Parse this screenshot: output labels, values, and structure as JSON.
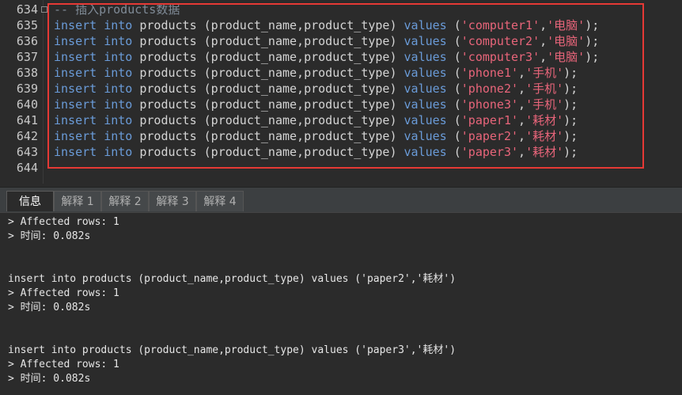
{
  "editor": {
    "lines": [
      {
        "num": "634",
        "kind": "comment",
        "text": "-- 插入products数据"
      },
      {
        "num": "635",
        "kind": "insert",
        "v1": "'computer1'",
        "v2": "'电脑'"
      },
      {
        "num": "636",
        "kind": "insert",
        "v1": "'computer2'",
        "v2": "'电脑'"
      },
      {
        "num": "637",
        "kind": "insert",
        "v1": "'computer3'",
        "v2": "'电脑'"
      },
      {
        "num": "638",
        "kind": "insert",
        "v1": "'phone1'",
        "v2": "'手机'"
      },
      {
        "num": "639",
        "kind": "insert",
        "v1": "'phone2'",
        "v2": "'手机'"
      },
      {
        "num": "640",
        "kind": "insert",
        "v1": "'phone3'",
        "v2": "'手机'"
      },
      {
        "num": "641",
        "kind": "insert",
        "v1": "'paper1'",
        "v2": "'耗材'"
      },
      {
        "num": "642",
        "kind": "insert",
        "v1": "'paper2'",
        "v2": "'耗材'"
      },
      {
        "num": "643",
        "kind": "insert",
        "v1": "'paper3'",
        "v2": "'耗材'"
      },
      {
        "num": "644",
        "kind": "empty"
      }
    ],
    "tokens": {
      "insert": "insert",
      "into": "into",
      "table": "products",
      "columns": "(product_name,product_type)",
      "values": "values",
      "open": "(",
      "comma": ",",
      "close": ");"
    },
    "highlight_color": "#e53935"
  },
  "tabs": [
    {
      "label": "信息",
      "active": true
    },
    {
      "label": "解释 1",
      "active": false
    },
    {
      "label": "解释 2",
      "active": false
    },
    {
      "label": "解释 3",
      "active": false
    },
    {
      "label": "解释 4",
      "active": false
    }
  ],
  "output": {
    "lines": [
      "> Affected rows: 1",
      "> 时间: 0.082s",
      "",
      "",
      "insert into products (product_name,product_type) values ('paper2','耗材')",
      "> Affected rows: 1",
      "> 时间: 0.082s",
      "",
      "",
      "insert into products (product_name,product_type) values ('paper3','耗材')",
      "> Affected rows: 1",
      "> 时间: 0.082s"
    ]
  }
}
